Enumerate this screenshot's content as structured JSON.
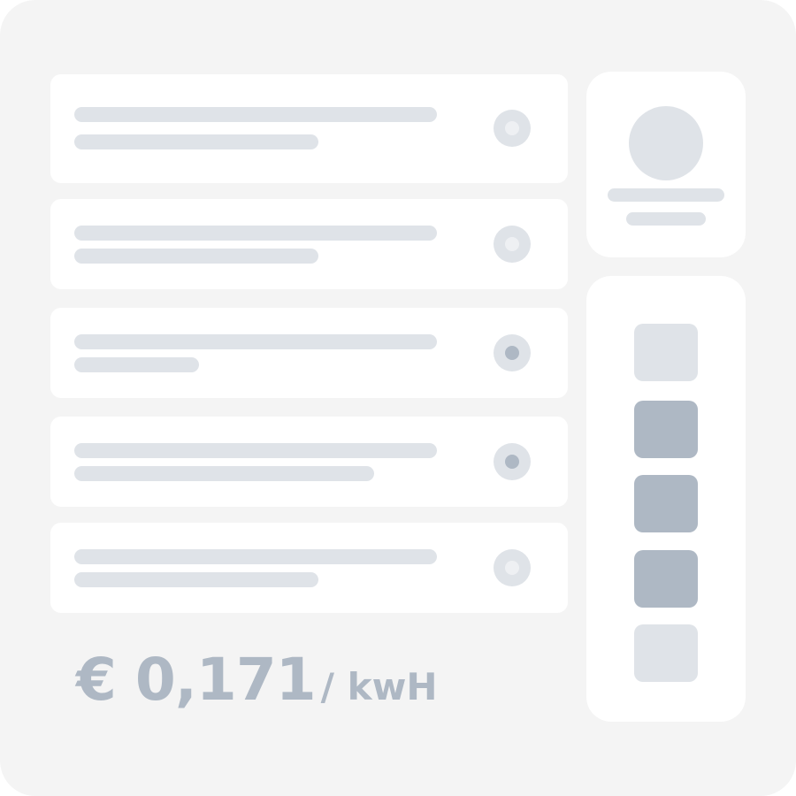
{
  "list": {
    "items": [
      {
        "selected": false
      },
      {
        "selected": false
      },
      {
        "selected": true
      },
      {
        "selected": true
      },
      {
        "selected": false
      }
    ]
  },
  "swatches": [
    {
      "selected": false
    },
    {
      "selected": true
    },
    {
      "selected": true
    },
    {
      "selected": true
    },
    {
      "selected": false
    }
  ],
  "price": {
    "amount": "€ 0,171",
    "unit": "/ kwH"
  },
  "colors": {
    "background": "#f4f4f4",
    "card": "#ffffff",
    "placeholder": "#dfe3e8",
    "accent": "#aeb8c4"
  }
}
